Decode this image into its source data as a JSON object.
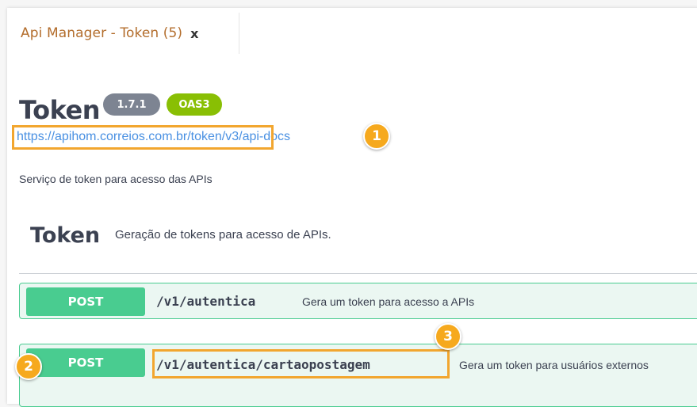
{
  "tab": {
    "title": "Api Manager - Token (5)",
    "close_label": "x"
  },
  "api": {
    "title": "Token",
    "version": "1.7.1",
    "spec": "OAS3",
    "url": "https://apihom.correios.com.br/token/v3/api-docs",
    "description": "Serviço de token para acesso das APIs"
  },
  "section": {
    "title": "Token",
    "description": "Geração de tokens para acesso de APIs."
  },
  "operations": [
    {
      "method": "POST",
      "path": "/v1/autentica",
      "summary": "Gera um token para acesso a APIs"
    },
    {
      "method": "POST",
      "path": "/v1/autentica/cartaopostagem",
      "summary": "Gera um token para usuários externos"
    }
  ],
  "markers": [
    "1",
    "2",
    "3"
  ],
  "colors": {
    "post": "#49cc90",
    "post_bg": "#ebf7f2",
    "marker": "#f6a91e",
    "link": "#4990e2",
    "tab_title": "#b36d2c",
    "version_badge": "#7d8492",
    "oas_badge": "#89bf04"
  }
}
